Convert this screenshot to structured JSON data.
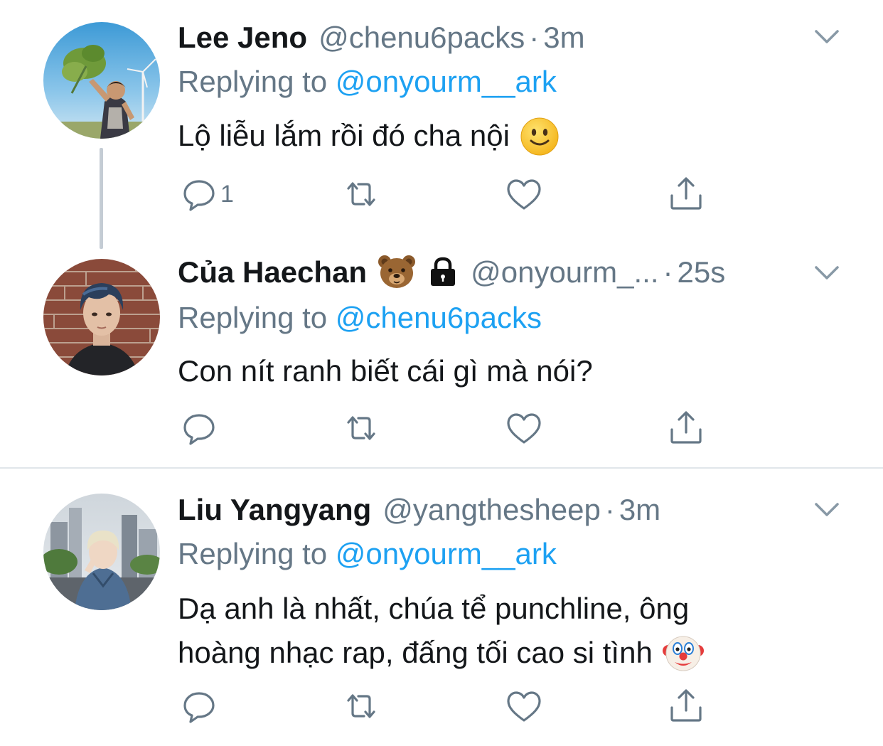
{
  "tweets": [
    {
      "name": "Lee Jeno",
      "handle": "@chenu6packs",
      "separator": "·",
      "time": "3m",
      "replying_prefix": "Replying to ",
      "replying_to": "@onyourm__ark",
      "text_lines": [
        "Lộ liễu lắm rồi đó cha nội"
      ],
      "text_emoji": "slightly-smiling-face",
      "reply_count": "1",
      "icons": [
        "reply-icon",
        "retweet-icon",
        "like-icon",
        "share-icon",
        "chevron-down-icon"
      ]
    },
    {
      "name": "Của Haechan",
      "name_emojis": [
        "bear-face",
        "lock"
      ],
      "handle": "@onyourm_...",
      "separator": "·",
      "time": "25s",
      "replying_prefix": "Replying to ",
      "replying_to": "@chenu6packs",
      "text_lines": [
        "Con nít ranh biết cái gì mà nói?"
      ],
      "reply_count": "",
      "icons": [
        "reply-icon",
        "retweet-icon",
        "like-icon",
        "share-icon",
        "chevron-down-icon"
      ]
    },
    {
      "name": "Liu Yangyang",
      "handle": "@yangthesheep",
      "separator": "·",
      "time": "3m",
      "replying_prefix": "Replying to ",
      "replying_to": "@onyourm__ark",
      "text_lines": [
        "Dạ anh là nhất, chúa tể punchline, ông",
        "hoàng nhạc rap, đấng tối cao si tình"
      ],
      "text_emoji": "clown-face",
      "reply_count": "",
      "icons": [
        "reply-icon",
        "retweet-icon",
        "like-icon",
        "share-icon",
        "chevron-down-icon"
      ]
    }
  ],
  "colors": {
    "link": "#1da1f2",
    "secondary": "#657786",
    "primary_text": "#14171a",
    "thread_line": "#c4ccd4",
    "divider": "#e1e6ea"
  }
}
